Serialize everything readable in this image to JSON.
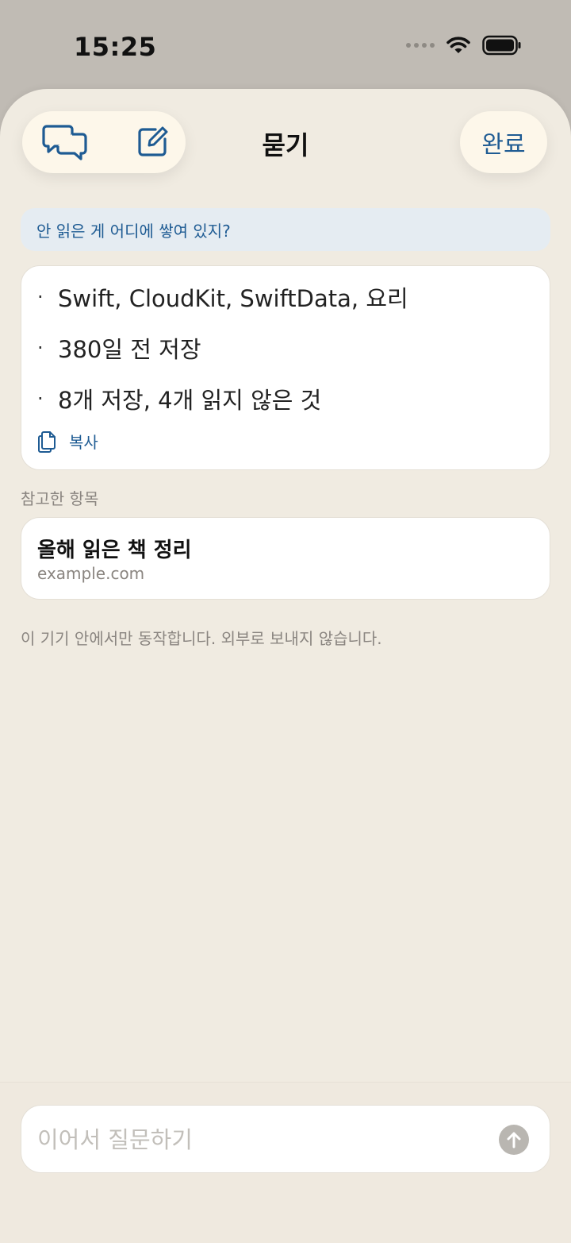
{
  "status": {
    "time": "15:25"
  },
  "header": {
    "title": "묻기",
    "done_label": "완료"
  },
  "question": "안 읽은 게 어디에 쌓여 있지?",
  "answer": {
    "bullets": [
      "Swift, CloudKit, SwiftData, 요리",
      "380일 전 저장",
      "8개 저장, 4개 읽지 않은 것"
    ],
    "copy_label": "복사"
  },
  "references": {
    "label": "참고한 항목",
    "items": [
      {
        "title": "올해 읽은 책 정리",
        "url": "example.com"
      }
    ]
  },
  "disclaimer": "이 기기 안에서만 동작합니다. 외부로 보내지 않습니다.",
  "input": {
    "placeholder": "이어서 질문하기",
    "value": ""
  },
  "colors": {
    "accent": "#1e5b93",
    "sheet": "#f0ebe1",
    "pill": "#fdf7ea"
  }
}
